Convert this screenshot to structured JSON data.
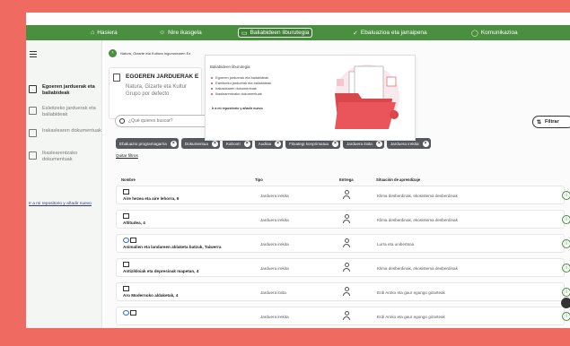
{
  "topnav": {
    "items": [
      {
        "icon": "home-icon",
        "label": "Hasiera"
      },
      {
        "icon": "people-icon",
        "label": "Nire ikasgela"
      },
      {
        "icon": "folder-icon",
        "label": "Baliabideen liburutegia"
      },
      {
        "icon": "checklist-icon",
        "label": "Ebaluazioa eta jarraipena"
      },
      {
        "icon": "chat-icon",
        "label": "Komunikazioa"
      }
    ],
    "accent": "#4a8f3f"
  },
  "sidebar": {
    "items": [
      {
        "label": "Egoeren jarduerak eta baliabideak",
        "active": true
      },
      {
        "label": "Esleitzeko jarduerak eta baliabideak",
        "active": false
      },
      {
        "label": "Irakaslearen dokumentuak",
        "active": false
      },
      {
        "label": "Ikaslearentzako dokumentuak",
        "active": false
      }
    ],
    "link": "Ir a mi repositorio y añadir nuevo"
  },
  "breadcrumb": "Natura, Gizarte eta Kultura Ingurunearen Ez",
  "resource_card": {
    "title": "EGOEREN JARDUERAK E",
    "subtitle": "Natura, Gizarte eta Kultur Grupo por defecto"
  },
  "popup": {
    "title": "Baliabideen liburutegia",
    "items": [
      "Egoeren jarduerak eta baliabideak",
      "Esleitzeko jarduerak eta baliabideak",
      "Irakaslearen dokumentuak",
      "Ikaslearentzako dokumentuak"
    ],
    "link": "Ir a mi repositorio y añadir nuevo"
  },
  "search": {
    "placeholder": "¿Qué quieres buscar?"
  },
  "filter_button": "Filtrar",
  "chips": [
    "Ebaluazio programagarria",
    "Dokumentua",
    "Kahoot!",
    "Audioa",
    "Fitxategi konprimatua",
    "Jarduera itxita",
    "Jarduera irekita"
  ],
  "clear_filters": "Quitar filtros",
  "table": {
    "headers": {
      "name": "Nombre",
      "tipo": "Tipo",
      "entrega": "Entrega",
      "situacion": "Situación de aprendizaje"
    },
    "rows": [
      {
        "name": "Aire hezea eta aire lehorra, 6",
        "tipo": "Jarduera irekita",
        "situacion": "Klima desberdinak, ekosistema desberdinak",
        "double_icon": false
      },
      {
        "name": "Altitudea, 4",
        "tipo": "Jarduera irekita",
        "situacion": "Klima desberdinak, ekosistema desberdinak",
        "double_icon": false
      },
      {
        "name": "Animalien eta landareen ablaketa batzuk, Taiwerra",
        "tipo": "Jarduera irekita",
        "situacion": "Lurra eta unibertsoa",
        "double_icon": true
      },
      {
        "name": "Antizikloiak eta depresioak mapetan, 4",
        "tipo": "Jarduera irekita",
        "situacion": "Klima desberdinak, ekosistema desberdinak",
        "double_icon": false
      },
      {
        "name": "Aro Modernoko aldaketak, 4",
        "tipo": "Jarduera itxita",
        "situacion": "Erdi Aroko eta gaur egungo gizarteak",
        "double_icon": false
      },
      {
        "name": "",
        "tipo": "Jarduera irekita",
        "situacion": "Erdi Aroko eta gaur egungo gizarteak",
        "double_icon": true
      }
    ]
  }
}
